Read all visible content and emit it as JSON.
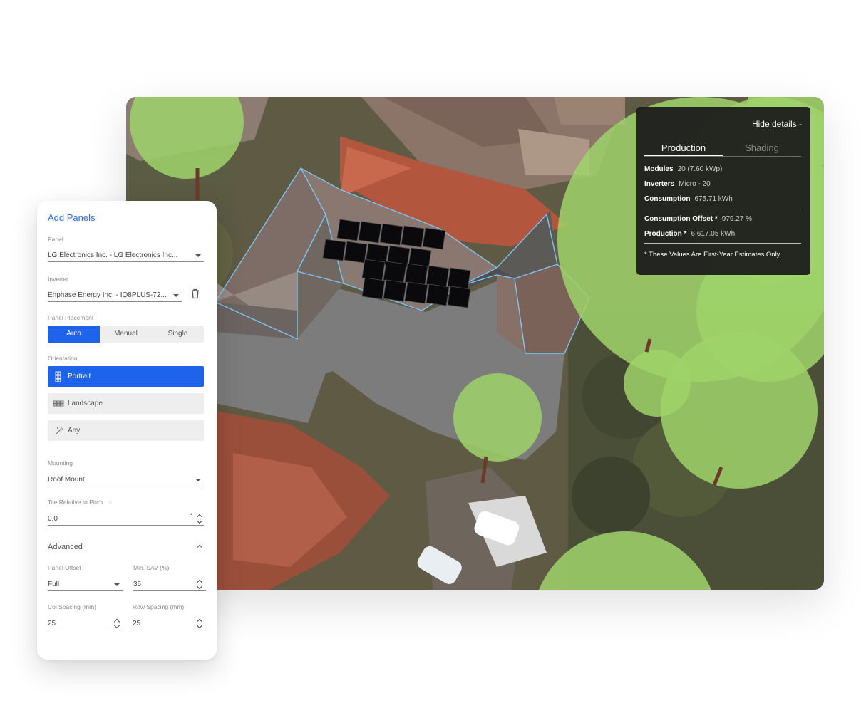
{
  "map": {
    "details_panel": {
      "hide_label": "Hide details -",
      "tabs": [
        {
          "label": "Production",
          "active": true
        },
        {
          "label": "Shading",
          "active": false
        }
      ],
      "modules": {
        "label": "Modules",
        "value": "20 (7.60 kWp)"
      },
      "inverters": {
        "label": "Inverters",
        "value": "Micro - 20"
      },
      "consumption": {
        "label": "Consumption",
        "value": "675.71 kWh"
      },
      "consumption_offset": {
        "label": "Consumption Offset *",
        "value": "979.27 %"
      },
      "production": {
        "label": "Production *",
        "value": "6,617.05 kWh"
      },
      "note": "* These Values Are First-Year Estimates Only"
    },
    "solar_panels_count": 20
  },
  "add_panels": {
    "title": "Add Panels",
    "panel": {
      "label": "Panel",
      "value": "LG Electronics Inc. - LG Electronics Inc..."
    },
    "inverter": {
      "label": "Inverter",
      "value": "Enphase Energy Inc. - IQ8PLUS-72..."
    },
    "placement": {
      "label": "Panel Placement",
      "options": [
        "Auto",
        "Manual",
        "Single"
      ],
      "selected": "Auto"
    },
    "orientation": {
      "label": "Orientation",
      "options": [
        {
          "label": "Portrait",
          "icon": "portrait-grid-icon",
          "selected": true
        },
        {
          "label": "Landscape",
          "icon": "landscape-grid-icon",
          "selected": false
        },
        {
          "label": "Any",
          "icon": "magic-wand-icon",
          "selected": false
        }
      ]
    },
    "mounting": {
      "label": "Mounting",
      "value": "Roof Mount"
    },
    "tilt": {
      "label": "Tile Relative to Pitch",
      "value": "0.0",
      "unit": "°"
    },
    "advanced": {
      "label": "Advanced",
      "panel_offset": {
        "label": "Panel Offset",
        "value": "Full"
      },
      "min_sav": {
        "label": "Min. SAV (%)",
        "value": "35"
      },
      "col_spacing": {
        "label": "Col Spacing (mm)",
        "value": "25"
      },
      "row_spacing": {
        "label": "Row Spacing (mm)",
        "value": "25"
      }
    }
  },
  "colors": {
    "accent_blue": "#1d63ec",
    "title_blue": "#2b6be6",
    "tree_green": "#9fd36a",
    "roof_outline": "#7ec3f0"
  }
}
